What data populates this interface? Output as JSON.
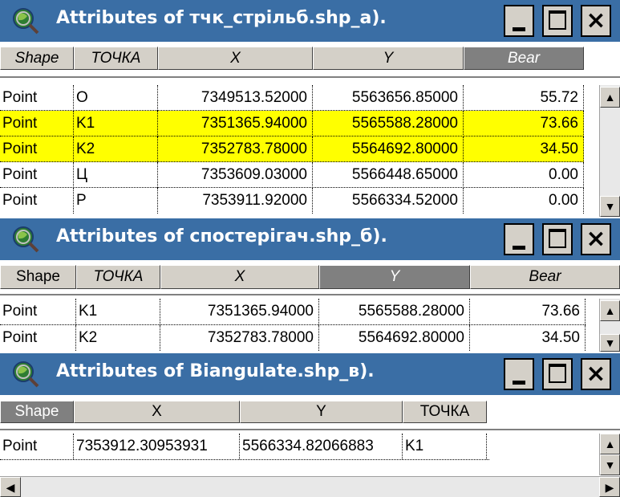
{
  "colors": {
    "titlebar": "#3a6ea5",
    "highlight": "#ffff00",
    "header": "#d4d0c8"
  },
  "window1": {
    "title": "Attributes of тчк_стрільб.shp_а).",
    "headers": [
      "Shape",
      "ТОЧКА",
      "X",
      "Y",
      "Bear"
    ],
    "rows": [
      [
        "Point",
        "O",
        "7349513.52000",
        "5563656.85000",
        "55.72"
      ],
      [
        "Point",
        "K1",
        "7351365.94000",
        "5565588.28000",
        "73.66"
      ],
      [
        "Point",
        "K2",
        "7352783.78000",
        "5564692.80000",
        "34.50"
      ],
      [
        "Point",
        "Ц",
        "7353609.03000",
        "5566448.65000",
        "0.00"
      ],
      [
        "Point",
        "P",
        "7353911.92000",
        "5566334.52000",
        "0.00"
      ]
    ],
    "highlighted_rows": [
      "K1",
      "K2"
    ],
    "selected_column": "Bear"
  },
  "window2": {
    "title": "Attributes of спостерігач.shp_б).",
    "headers": [
      "Shape",
      "ТОЧКА",
      "X",
      "Y",
      "Bear"
    ],
    "rows": [
      [
        "Point",
        "K1",
        "7351365.94000",
        "5565588.28000",
        "73.66"
      ],
      [
        "Point",
        "K2",
        "7352783.78000",
        "5564692.80000",
        "34.50"
      ]
    ],
    "selected_column": "Y"
  },
  "window3": {
    "title": "Attributes of Biangulate.shp_в).",
    "headers": [
      "Shape",
      "X",
      "Y",
      "ТОЧКА"
    ],
    "rows": [
      [
        "Point",
        "7353912.30953931",
        "5566334.82066883",
        "K1"
      ]
    ],
    "selected_column": "Shape"
  },
  "controls": {
    "minimize": "_",
    "close": "×"
  },
  "icons": {
    "app": "globe-magnifier-icon",
    "scroll_up": "▲",
    "scroll_down": "▼",
    "scroll_left": "◀",
    "scroll_right": "▶"
  }
}
